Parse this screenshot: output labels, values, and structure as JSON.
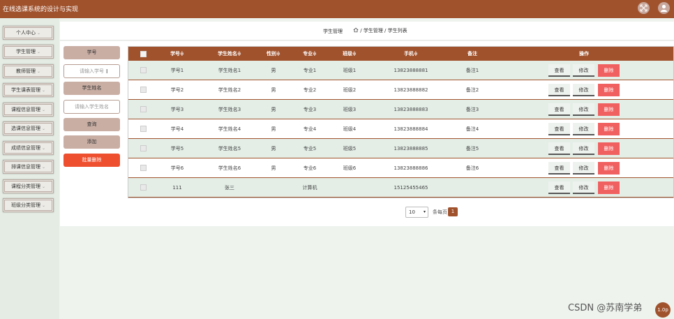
{
  "app": {
    "title": "在线选课系统的设计与实现"
  },
  "sidebar": {
    "items": [
      {
        "label": "个人中心"
      },
      {
        "label": "学生管理"
      },
      {
        "label": "教师管理"
      },
      {
        "label": "学生课表管理"
      },
      {
        "label": "课程信息管理"
      },
      {
        "label": "选课信息管理"
      },
      {
        "label": "成绩信息管理"
      },
      {
        "label": "排课信息管理"
      },
      {
        "label": "课程分类管理"
      },
      {
        "label": "班级分类管理"
      }
    ]
  },
  "header": {
    "title": "学生管理",
    "breadcrumb": "/ 学生管理 / 学生列表"
  },
  "filters": {
    "xuehao_label": "学号",
    "xuehao_placeholder": "请输入学号",
    "name_label": "学生姓名",
    "name_placeholder": "请输入学生姓名",
    "query_label": "查询",
    "add_label": "添加",
    "batch_delete_label": "批量删除"
  },
  "table": {
    "columns": [
      "学号≑",
      "学生姓名≑",
      "性别≑",
      "专业≑",
      "班级≑",
      "手机≑",
      "备注",
      "操作"
    ],
    "rows": [
      [
        "学号1",
        "学生姓名1",
        "男",
        "专业1",
        "班级1",
        "13823888881",
        "备注1"
      ],
      [
        "学号2",
        "学生姓名2",
        "男",
        "专业2",
        "班级2",
        "13823888882",
        "备注2"
      ],
      [
        "学号3",
        "学生姓名3",
        "男",
        "专业3",
        "班级3",
        "13823888883",
        "备注3"
      ],
      [
        "学号4",
        "学生姓名4",
        "男",
        "专业4",
        "班级4",
        "13823888884",
        "备注4"
      ],
      [
        "学号5",
        "学生姓名5",
        "男",
        "专业5",
        "班级5",
        "13823888885",
        "备注5"
      ],
      [
        "学号6",
        "学生姓名6",
        "男",
        "专业6",
        "班级6",
        "13823888886",
        "备注6"
      ],
      [
        "111",
        "张三",
        "",
        "计算机",
        "",
        "15125455465",
        ""
      ]
    ],
    "actions": {
      "view": "查看",
      "edit": "修改",
      "delete": "删除"
    }
  },
  "pagination": {
    "page_size": "10",
    "per_page_label": "条每页",
    "current_page": "1"
  },
  "watermark": {
    "text": "CSDN @苏南学弟"
  },
  "float_button": {
    "label": "1.0p"
  }
}
